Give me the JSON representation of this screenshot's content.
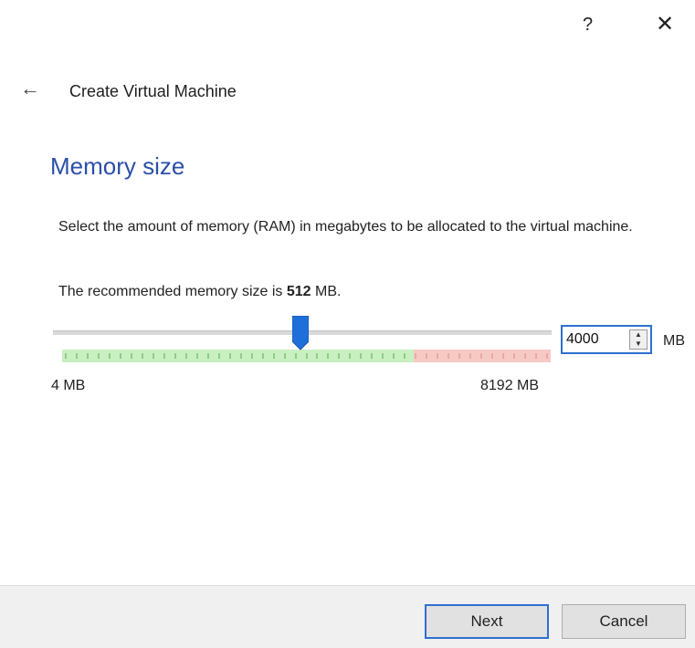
{
  "titlebar": {
    "help_label": "?",
    "close_label": "✕"
  },
  "header": {
    "back_icon": "←",
    "title": "Create Virtual Machine"
  },
  "page": {
    "heading": "Memory size",
    "description": "Select the amount of memory (RAM) in megabytes to be allocated to the virtual machine.",
    "recommended_prefix": "The recommended memory size is ",
    "recommended_value": "512",
    "recommended_suffix": " MB."
  },
  "memory": {
    "value": "4000",
    "unit": "MB",
    "min_label": "4 MB",
    "max_label": "8192 MB",
    "min": 4,
    "max": 8192,
    "current": 4000,
    "safe_limit": 5900,
    "colors": {
      "safe": "#c8f0c0",
      "warning": "#f7c9c4",
      "handle": "#1e6fd9",
      "accent": "#2b4fa8"
    }
  },
  "buttons": {
    "next": "Next",
    "cancel": "Cancel"
  }
}
